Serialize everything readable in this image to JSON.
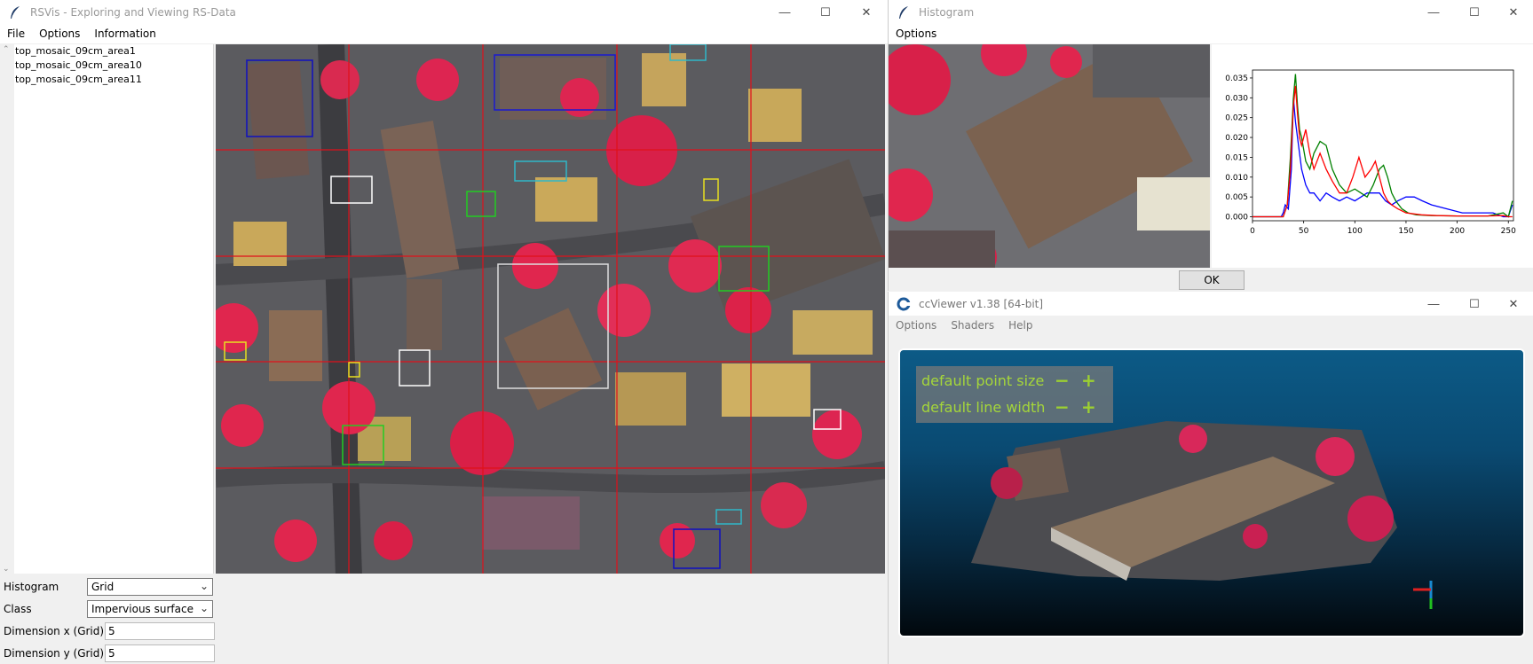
{
  "main_window": {
    "title": "RSVis - Exploring and Viewing RS-Data",
    "menu": [
      "File",
      "Options",
      "Information"
    ],
    "files": [
      "top_mosaic_09cm_area1",
      "top_mosaic_09cm_area10",
      "top_mosaic_09cm_area11"
    ],
    "controls": {
      "histogram_label": "Histogram",
      "histogram_value": "Grid",
      "class_label": "Class",
      "class_value": "Impervious surface",
      "dim_x_label": "Dimension x (Grid)",
      "dim_x_value": "5",
      "dim_y_label": "Dimension y (Grid)",
      "dim_y_value": "5"
    }
  },
  "histogram_window": {
    "title": "Histogram",
    "menu": [
      "Options"
    ],
    "ok_label": "OK"
  },
  "cc_window": {
    "title": "ccViewer v1.38 [64-bit]",
    "menu": [
      "Options",
      "Shaders",
      "Help"
    ],
    "hud": {
      "point_size_label": "default point size",
      "line_width_label": "default line width",
      "minus": "−",
      "plus": "+"
    }
  },
  "chart_data": {
    "type": "line",
    "title": "",
    "xlabel": "",
    "ylabel": "",
    "xlim": [
      0,
      255
    ],
    "ylim": [
      -0.001,
      0.037
    ],
    "x_ticks": [
      "0",
      "50",
      "100",
      "150",
      "200",
      "250"
    ],
    "y_ticks": [
      "0.000",
      "0.005",
      "0.010",
      "0.015",
      "0.020",
      "0.025",
      "0.030",
      "0.035"
    ],
    "series": [
      {
        "color": "#0000ff",
        "x": [
          0,
          28,
          30,
          32,
          35,
          38,
          40,
          42,
          44,
          46,
          48,
          52,
          56,
          60,
          66,
          72,
          78,
          85,
          92,
          100,
          106,
          112,
          118,
          124,
          130,
          136,
          142,
          150,
          158,
          166,
          175,
          190,
          205,
          220,
          235,
          245,
          250,
          254
        ],
        "values": [
          0,
          0,
          0.001,
          0.003,
          0.002,
          0.012,
          0.03,
          0.024,
          0.02,
          0.016,
          0.012,
          0.008,
          0.006,
          0.006,
          0.004,
          0.006,
          0.005,
          0.004,
          0.005,
          0.004,
          0.005,
          0.006,
          0.006,
          0.006,
          0.004,
          0.003,
          0.004,
          0.005,
          0.005,
          0.004,
          0.003,
          0.002,
          0.001,
          0.001,
          0.001,
          0.0,
          0.0,
          0.003
        ]
      },
      {
        "color": "#008000",
        "x": [
          0,
          30,
          34,
          37,
          40,
          42,
          44,
          46,
          48,
          52,
          56,
          60,
          66,
          72,
          78,
          85,
          92,
          100,
          106,
          112,
          118,
          124,
          128,
          132,
          136,
          140,
          146,
          152,
          160,
          175,
          200,
          230,
          245,
          250,
          254
        ],
        "values": [
          0,
          0,
          0.003,
          0.015,
          0.03,
          0.036,
          0.028,
          0.022,
          0.02,
          0.014,
          0.012,
          0.016,
          0.019,
          0.018,
          0.012,
          0.008,
          0.006,
          0.007,
          0.006,
          0.005,
          0.008,
          0.012,
          0.013,
          0.01,
          0.006,
          0.004,
          0.002,
          0.001,
          0.0005,
          0.0003,
          0.0002,
          0.0002,
          0.001,
          0.0,
          0.004
        ]
      },
      {
        "color": "#ff0000",
        "x": [
          0,
          30,
          34,
          37,
          40,
          42,
          44,
          46,
          48,
          52,
          56,
          60,
          66,
          72,
          78,
          85,
          92,
          98,
          104,
          110,
          116,
          120,
          124,
          128,
          132,
          136,
          142,
          150,
          165,
          180,
          200,
          230,
          245,
          250,
          254
        ],
        "values": [
          0,
          0,
          0.003,
          0.012,
          0.028,
          0.033,
          0.026,
          0.02,
          0.018,
          0.022,
          0.016,
          0.012,
          0.016,
          0.012,
          0.009,
          0.006,
          0.006,
          0.01,
          0.015,
          0.01,
          0.012,
          0.014,
          0.01,
          0.006,
          0.004,
          0.003,
          0.002,
          0.001,
          0.0005,
          0.0003,
          0.0002,
          0.0002,
          0.0003,
          0.0,
          0.0
        ]
      }
    ]
  }
}
